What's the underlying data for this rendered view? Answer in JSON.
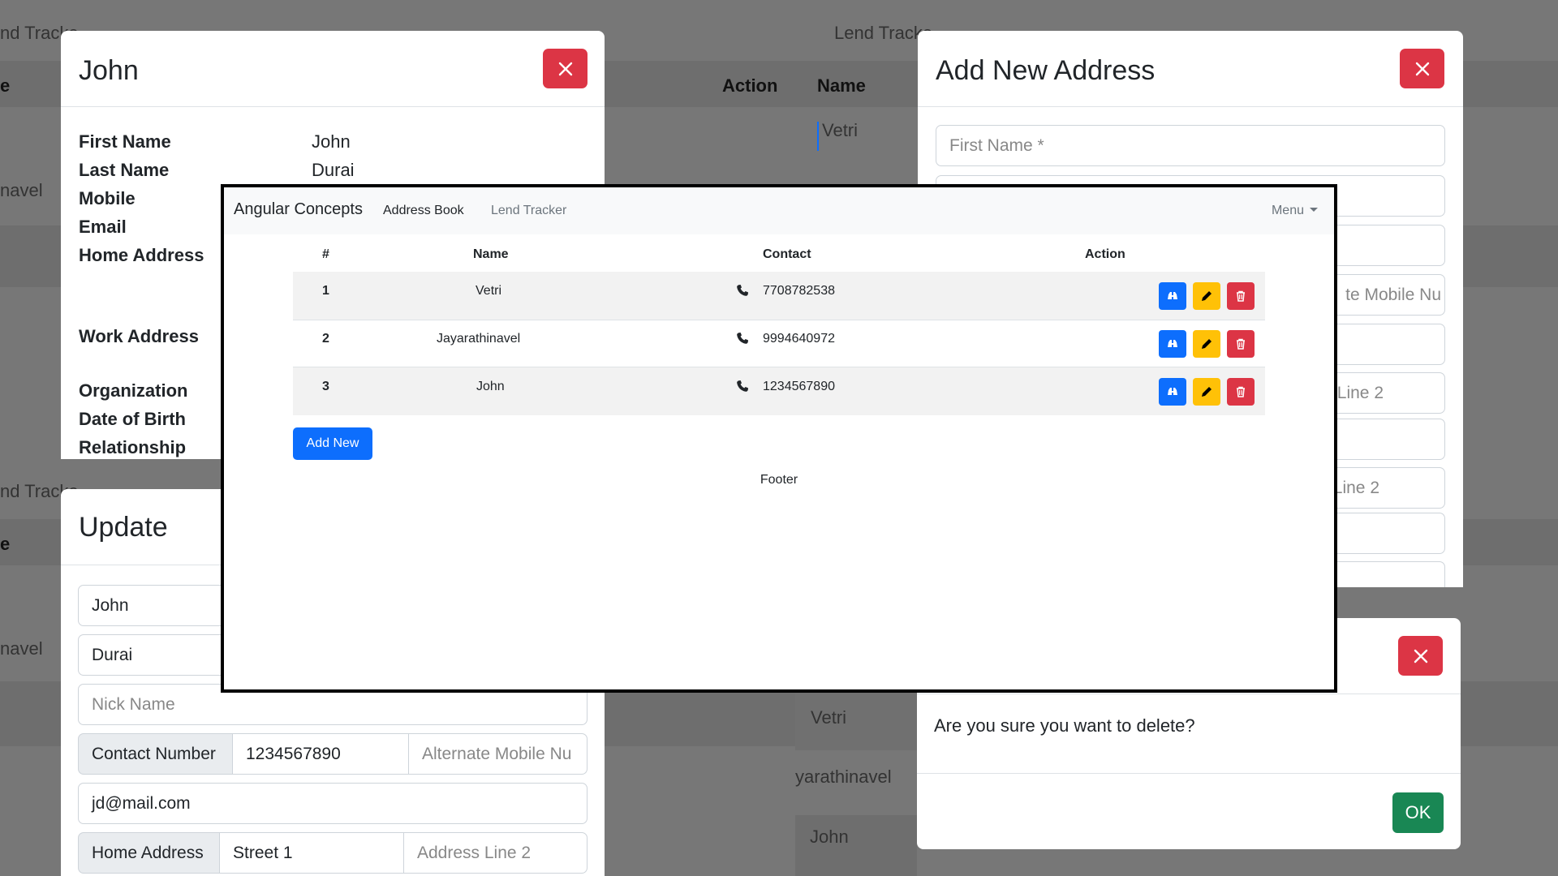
{
  "background": {
    "lend_tracker_fragment_1": "nd Tracke",
    "lend_tracker_fragment_2": "Lend Tracke",
    "lend_tracker_fragment_3": "nd Tracke",
    "col_fragment_1": "e",
    "col_fragment_2": "e",
    "action_header": "Action",
    "name_header": "Name",
    "bg_vetri_top": "Vetri",
    "bg_navel_1": "navel",
    "bg_navel_2": "navel",
    "bg_vetri_bottom": "Vetri",
    "bg_jayarathinavel": "yarathinavel",
    "bg_john": "John"
  },
  "details_modal": {
    "title": "John",
    "rows": [
      {
        "label": "First Name",
        "value": "John"
      },
      {
        "label": "Last Name",
        "value": "Durai"
      },
      {
        "label": "Mobile",
        "value": ""
      },
      {
        "label": "Email",
        "value": ""
      },
      {
        "label": "Home Address",
        "value": ""
      },
      {
        "label": "Work Address",
        "value": ""
      },
      {
        "label": "Organization",
        "value": ""
      },
      {
        "label": "Date of Birth",
        "value": ""
      },
      {
        "label": "Relationship",
        "value": ""
      }
    ]
  },
  "update_modal": {
    "title": "Update",
    "first_name": "John",
    "last_name": "Durai",
    "nick_name_placeholder": "Nick Name",
    "contact_label": "Contact Number",
    "contact_value": "1234567890",
    "alternate_placeholder": "Alternate Mobile Nu",
    "email_value": "jd@mail.com",
    "home_address_label": "Home Address",
    "street_value": "Street 1",
    "address_line2_placeholder": "Address Line 2"
  },
  "add_modal": {
    "title": "Add New Address",
    "first_name_placeholder": "First Name *",
    "alt_mobile_fragment": "te Mobile Nu",
    "line2_fragment_1": "Line 2",
    "line2_fragment_2": "Line 2"
  },
  "delete_modal": {
    "message": "Are you sure you want to delete?",
    "ok_label": "OK"
  },
  "app": {
    "brand": "Angular Concepts",
    "nav_address_book": "Address Book",
    "nav_lend_tracker": "Lend Tracker",
    "menu_label": "Menu",
    "headers": {
      "num": "#",
      "name": "Name",
      "contact": "Contact",
      "action": "Action"
    },
    "rows": [
      {
        "num": "1",
        "name": "Vetri",
        "contact": "7708782538"
      },
      {
        "num": "2",
        "name": "Jayarathinavel",
        "contact": "9994640972"
      },
      {
        "num": "3",
        "name": "John",
        "contact": "1234567890"
      }
    ],
    "add_new_label": "Add New",
    "footer": "Footer"
  },
  "colors": {
    "primary": "#0d6efd",
    "warning": "#ffc107",
    "danger": "#dc3545",
    "success": "#198754"
  },
  "icons": {
    "close": "close-icon",
    "phone": "phone-icon",
    "view": "binoculars-icon",
    "edit": "pencil-icon",
    "delete": "trash-icon"
  }
}
